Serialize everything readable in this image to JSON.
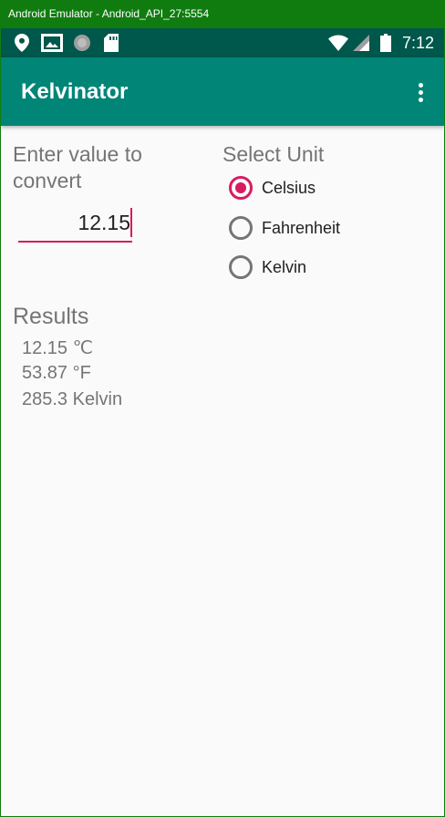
{
  "window": {
    "title": "Android Emulator - Android_API_27:5554"
  },
  "status_bar": {
    "time": "7:12",
    "left_icons": [
      "location-icon",
      "gallery-icon",
      "sync-icon",
      "sd-card-icon"
    ],
    "right_icons": [
      "wifi-icon",
      "signal-icon",
      "battery-icon"
    ]
  },
  "app_bar": {
    "title": "Kelvinator",
    "menu_icon": "more-vert-icon"
  },
  "input": {
    "label": "Enter value to convert",
    "value": "12.15"
  },
  "units": {
    "label": "Select Unit",
    "options": [
      {
        "label": "Celsius",
        "checked": true
      },
      {
        "label": "Fahrenheit",
        "checked": false
      },
      {
        "label": "Kelvin",
        "checked": false
      }
    ]
  },
  "results": {
    "label": "Results",
    "lines": [
      "12.15 ℃",
      "53.87 °F",
      "285.3 Kelvin"
    ]
  },
  "colors": {
    "window_frame": "#107c10",
    "status_bar": "#00574b",
    "app_bar": "#008577",
    "accent": "#d81b60",
    "background": "#fafafa",
    "secondary_text": "#757575"
  }
}
